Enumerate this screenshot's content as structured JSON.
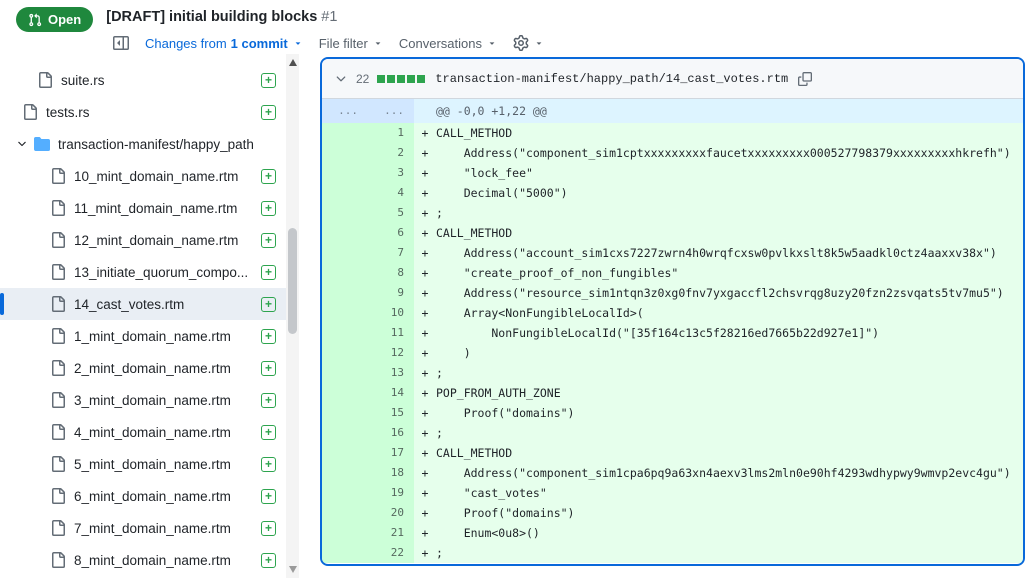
{
  "colors": {
    "open_green": "#1f883d",
    "link_blue": "#0969da",
    "selected_accent": "#0969da",
    "selected_row_bg": "#e9eef4",
    "diffstat_green": "#2da44e",
    "addition_row_bg": "#e6ffec",
    "addition_gutter_bg": "#ccffd8",
    "hunk_row_bg": "#ddf4ff",
    "hunk_gutter_bg": "#d1e7ff"
  },
  "pr_header": {
    "state_label": "Open",
    "title": "[DRAFT] initial building blocks",
    "number": "#1",
    "changes_prefix": "Changes from",
    "changes_count": "1 commit",
    "file_filter": "File filter",
    "conversations": "Conversations"
  },
  "file_tree": {
    "items": [
      {
        "name": "suite.rs",
        "type": "file",
        "depth": 2
      },
      {
        "name": "tests.rs",
        "type": "file",
        "depth": 1
      },
      {
        "name": "transaction-manifest/happy_path",
        "type": "folder",
        "depth": 0,
        "expanded": true
      },
      {
        "name": "10_mint_domain_name.rtm",
        "type": "file",
        "depth": 3
      },
      {
        "name": "11_mint_domain_name.rtm",
        "type": "file",
        "depth": 3
      },
      {
        "name": "12_mint_domain_name.rtm",
        "type": "file",
        "depth": 3
      },
      {
        "name": "13_initiate_quorum_compo...",
        "type": "file",
        "depth": 3
      },
      {
        "name": "14_cast_votes.rtm",
        "type": "file",
        "depth": 3,
        "selected": true
      },
      {
        "name": "1_mint_domain_name.rtm",
        "type": "file",
        "depth": 3
      },
      {
        "name": "2_mint_domain_name.rtm",
        "type": "file",
        "depth": 3
      },
      {
        "name": "3_mint_domain_name.rtm",
        "type": "file",
        "depth": 3
      },
      {
        "name": "4_mint_domain_name.rtm",
        "type": "file",
        "depth": 3
      },
      {
        "name": "5_mint_domain_name.rtm",
        "type": "file",
        "depth": 3
      },
      {
        "name": "6_mint_domain_name.rtm",
        "type": "file",
        "depth": 3
      },
      {
        "name": "7_mint_domain_name.rtm",
        "type": "file",
        "depth": 3
      },
      {
        "name": "8_mint_domain_name.rtm",
        "type": "file",
        "depth": 3
      }
    ]
  },
  "diff": {
    "file_path": "transaction-manifest/happy_path/14_cast_votes.rtm",
    "changed_lines_count": "22",
    "diffstat_blocks": [
      "add",
      "add",
      "add",
      "add",
      "add"
    ],
    "hunk": {
      "old": "...",
      "new": "...",
      "text": "@@ -0,0 +1,22 @@"
    },
    "lines": [
      {
        "num": "1",
        "sign": "+",
        "code": "CALL_METHOD"
      },
      {
        "num": "2",
        "sign": "+",
        "code": "    Address(\"component_sim1cptxxxxxxxxxfaucetxxxxxxxxx000527798379xxxxxxxxxhkrefh\")"
      },
      {
        "num": "3",
        "sign": "+",
        "code": "    \"lock_fee\""
      },
      {
        "num": "4",
        "sign": "+",
        "code": "    Decimal(\"5000\")"
      },
      {
        "num": "5",
        "sign": "+",
        "code": ";"
      },
      {
        "num": "6",
        "sign": "+",
        "code": "CALL_METHOD"
      },
      {
        "num": "7",
        "sign": "+",
        "code": "    Address(\"account_sim1cxs7227zwrn4h0wrqfcxsw0pvlkxslt8k5w5aadkl0ctz4aaxxv38x\")"
      },
      {
        "num": "8",
        "sign": "+",
        "code": "    \"create_proof_of_non_fungibles\""
      },
      {
        "num": "9",
        "sign": "+",
        "code": "    Address(\"resource_sim1ntqn3z0xg0fnv7yxgaccfl2chsvrqg8uzy20fzn2zsvqats5tv7mu5\")"
      },
      {
        "num": "10",
        "sign": "+",
        "code": "    Array<NonFungibleLocalId>("
      },
      {
        "num": "11",
        "sign": "+",
        "code": "        NonFungibleLocalId(\"[35f164c13c5f28216ed7665b22d927e1]\")"
      },
      {
        "num": "12",
        "sign": "+",
        "code": "    )"
      },
      {
        "num": "13",
        "sign": "+",
        "code": ";"
      },
      {
        "num": "14",
        "sign": "+",
        "code": "POP_FROM_AUTH_ZONE"
      },
      {
        "num": "15",
        "sign": "+",
        "code": "    Proof(\"domains\")"
      },
      {
        "num": "16",
        "sign": "+",
        "code": ";"
      },
      {
        "num": "17",
        "sign": "+",
        "code": "CALL_METHOD"
      },
      {
        "num": "18",
        "sign": "+",
        "code": "    Address(\"component_sim1cpa6pq9a63xn4aexv3lms2mln0e90hf4293wdhypwy9wmvp2evc4gu\")"
      },
      {
        "num": "19",
        "sign": "+",
        "code": "    \"cast_votes\""
      },
      {
        "num": "20",
        "sign": "+",
        "code": "    Proof(\"domains\")"
      },
      {
        "num": "21",
        "sign": "+",
        "code": "    Enum<0u8>()"
      },
      {
        "num": "22",
        "sign": "+",
        "code": ";"
      }
    ]
  }
}
